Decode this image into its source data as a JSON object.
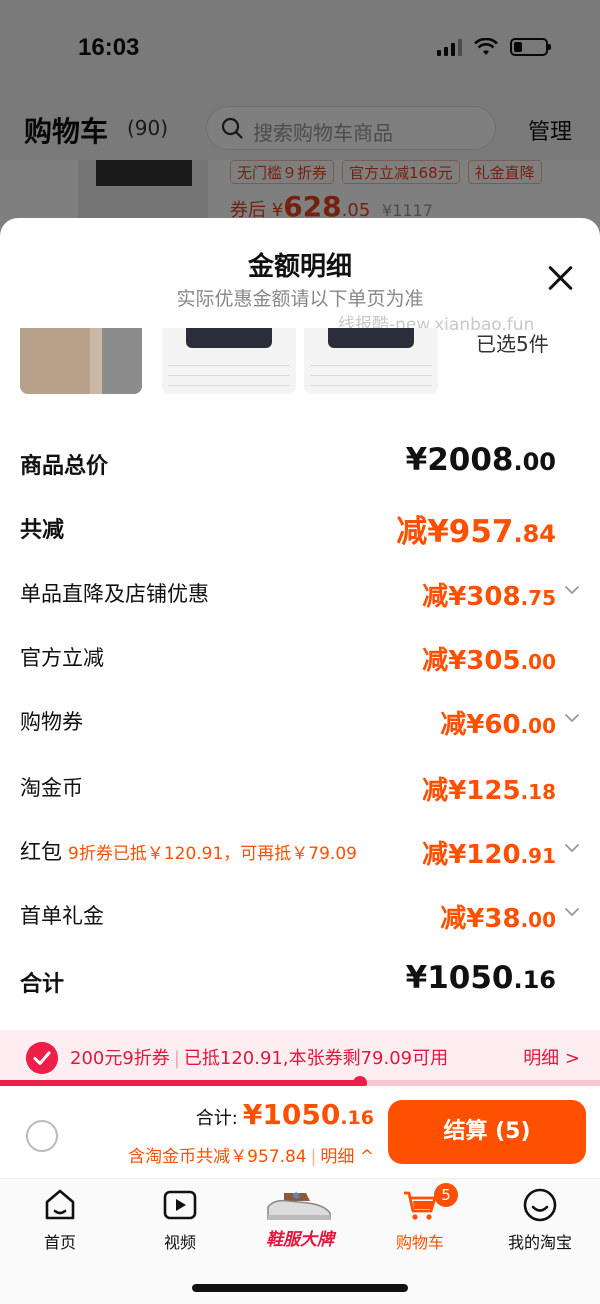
{
  "status_bar": {
    "time": "16:03"
  },
  "cart_header": {
    "title": "购物车",
    "count": "(90)",
    "search_placeholder": "搜索购物车商品",
    "manage_label": "管理"
  },
  "background_item": {
    "tags": [
      "无门槛９折券",
      "官方立减168元",
      "礼金直降"
    ],
    "price_prefix": "券后",
    "price_currency": "¥",
    "price_main": "628",
    "price_dec": ".05",
    "price_original": "¥1117"
  },
  "sheet": {
    "title": "金额明细",
    "subtitle": "实际优惠金额请以下单页为准",
    "watermark": "线报酷-new.xianbao.fun",
    "selected_count": "已选5件"
  },
  "details": [
    {
      "label": "商品总价",
      "note": "",
      "prefix": "",
      "currency": "¥",
      "int": "2008",
      "dec": ".00",
      "style": "black-big",
      "expandable": false,
      "bold": true
    },
    {
      "label": "共减",
      "note": "",
      "prefix": "减",
      "currency": "¥",
      "int": "957",
      "dec": ".84",
      "style": "orange-big",
      "expandable": false,
      "bold": true
    },
    {
      "label": "单品直降及店铺优惠",
      "note": "",
      "prefix": "减",
      "currency": "¥",
      "int": "308",
      "dec": ".75",
      "style": "orange",
      "expandable": true,
      "bold": false
    },
    {
      "label": "官方立减",
      "note": "",
      "prefix": "减",
      "currency": "¥",
      "int": "305",
      "dec": ".00",
      "style": "orange",
      "expandable": false,
      "bold": false
    },
    {
      "label": "购物券",
      "note": "",
      "prefix": "减",
      "currency": "¥",
      "int": "60",
      "dec": ".00",
      "style": "orange",
      "expandable": true,
      "bold": false
    },
    {
      "label": "淘金币",
      "note": "",
      "prefix": "减",
      "currency": "¥",
      "int": "125",
      "dec": ".18",
      "style": "orange",
      "expandable": false,
      "bold": false
    },
    {
      "label": "红包",
      "note": "9折券已抵￥120.91，可再抵￥79.09",
      "prefix": "减",
      "currency": "¥",
      "int": "120",
      "dec": ".91",
      "style": "orange",
      "expandable": true,
      "bold": false
    },
    {
      "label": "首单礼金",
      "note": "",
      "prefix": "减",
      "currency": "¥",
      "int": "38",
      "dec": ".00",
      "style": "orange",
      "expandable": true,
      "bold": false
    },
    {
      "label": "合计",
      "note": "",
      "prefix": "",
      "currency": "¥",
      "int": "1050",
      "dec": ".16",
      "style": "black-big",
      "expandable": false,
      "bold": true
    }
  ],
  "coupon_bar": {
    "part1": "200元9折券",
    "part2": "已抵120.91,本张券剩79.09可用",
    "detail_label": "明细 >",
    "progress_fraction": 0.6
  },
  "checkout": {
    "total_label": "合计:",
    "total_currency": "¥",
    "total_int": "1050",
    "total_dec": ".16",
    "saved_text": "含淘金币共减￥957.84",
    "saved_detail": "明细 ^",
    "button_label": "结算 (5)"
  },
  "tabbar": {
    "home": "首页",
    "video": "视频",
    "promo": "鞋服大牌",
    "cart": "购物车",
    "cart_badge": "5",
    "mine": "我的淘宝"
  },
  "colors": {
    "accent": "#ff5000",
    "coupon_red": "#ee1e4b"
  }
}
